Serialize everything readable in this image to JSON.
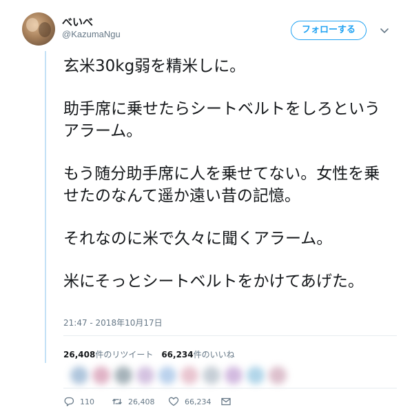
{
  "user": {
    "display_name": "べいべ",
    "handle": "@KazumaNgu",
    "avatar_icon": "avatar-photo"
  },
  "follow_button": {
    "label": "フォローする",
    "color": "#1da1f2"
  },
  "menu": {
    "icon": "chevron-down-icon"
  },
  "tweet": {
    "paragraphs": [
      "玄米30kg弱を精米しに。",
      "助手席に乗せたらシートベルトをしろというアラーム。",
      "もう随分助手席に人を乗せてない。女性を乗せたのなんて遥か遠い昔の記憶。",
      "それなのに米で久々に聞くアラーム。",
      "米にそっとシートベルトをかけてあげた。"
    ],
    "timestamp": "21:47 - 2018年10月17日"
  },
  "stats": {
    "retweets_count": "26,408",
    "retweets_label": "件のリツイート",
    "likes_count": "66,234",
    "likes_label": "件のいいね"
  },
  "actions": {
    "reply_count": "110",
    "retweet_count": "26,408",
    "like_count": "66,234",
    "reply_icon": "reply-icon",
    "retweet_icon": "retweet-icon",
    "like_icon": "heart-icon",
    "dm_icon": "envelope-icon"
  },
  "colors": {
    "accent": "#1da1f2",
    "text_primary": "#14171a",
    "text_secondary": "#657786",
    "thread_line": "#c4e1f6"
  }
}
